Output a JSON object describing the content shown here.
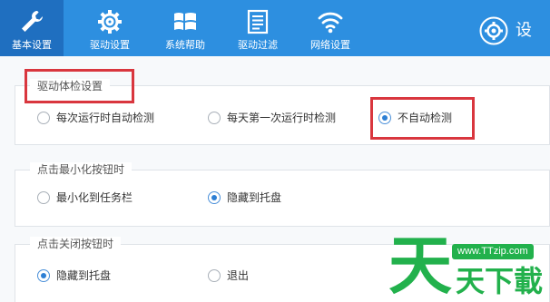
{
  "toolbar": {
    "items": [
      {
        "label": "基本设置",
        "icon": "wrench-icon",
        "active": true
      },
      {
        "label": "驱动设置",
        "icon": "gear-icon",
        "active": false
      },
      {
        "label": "系统帮助",
        "icon": "windows-logo-icon",
        "active": false
      },
      {
        "label": "驱动过滤",
        "icon": "list-icon",
        "active": false
      },
      {
        "label": "网络设置",
        "icon": "wifi-icon",
        "active": false
      }
    ],
    "settings_label": "设"
  },
  "groups": {
    "driver_check": {
      "title": "驱动体检设置",
      "options": [
        {
          "label": "每次运行时自动检测",
          "selected": false
        },
        {
          "label": "每天第一次运行时检测",
          "selected": false
        },
        {
          "label": "不自动检测",
          "selected": true
        }
      ]
    },
    "minimize": {
      "title": "点击最小化按钮时",
      "options": [
        {
          "label": "最小化到任务栏",
          "selected": false
        },
        {
          "label": "隐藏到托盘",
          "selected": true
        }
      ]
    },
    "close": {
      "title": "点击关闭按钮时",
      "options": [
        {
          "label": "隐藏到托盘",
          "selected": true
        },
        {
          "label": "退出",
          "selected": false
        }
      ]
    }
  },
  "watermark": {
    "big_char": "天",
    "text": "天下載",
    "url": "www.TTzip.com"
  },
  "colors": {
    "toolbar_bg": "#2d8fe0",
    "toolbar_active": "#1f6fc0",
    "highlight_red": "#d9363e",
    "watermark_green": "#22b14c"
  }
}
